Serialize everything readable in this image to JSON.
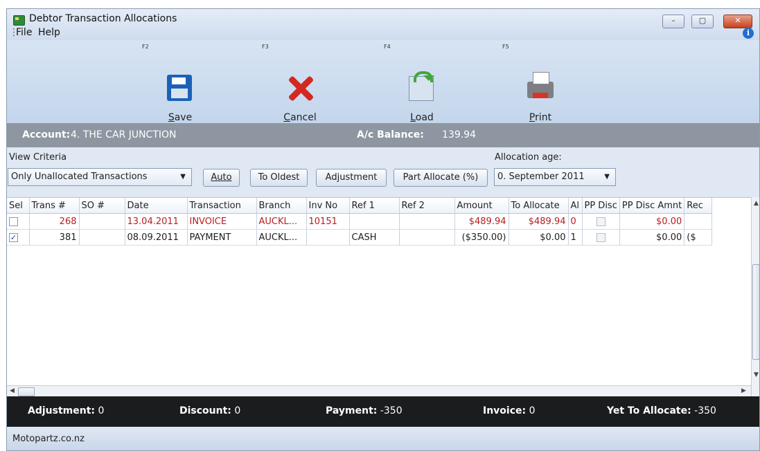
{
  "window": {
    "title": "Debtor Transaction Allocations"
  },
  "menu": {
    "items": [
      "File",
      "Help"
    ]
  },
  "toolbar": {
    "tools": [
      {
        "fkey": "F2",
        "label": "Save",
        "accel": "S",
        "icon": "save-icon"
      },
      {
        "fkey": "F3",
        "label": "Cancel",
        "accel": "C",
        "icon": "cancel-icon"
      },
      {
        "fkey": "F4",
        "label": "Load",
        "accel": "L",
        "icon": "load-icon"
      },
      {
        "fkey": "F5",
        "label": "Print",
        "accel": "P",
        "icon": "print-icon"
      }
    ]
  },
  "account": {
    "label": "Account:",
    "value": "4. THE CAR JUNCTION",
    "balance_label": "A/c Balance:",
    "balance_value": "139.94"
  },
  "criteria": {
    "view_label": "View Criteria",
    "view_value": "Only Unallocated Transactions",
    "buttons": [
      "Auto",
      "To Oldest",
      "Adjustment",
      "Part Allocate (%)"
    ],
    "age_label": "Allocation age:",
    "age_value": "0. September 2011"
  },
  "grid": {
    "columns": [
      "Sel",
      "Trans #",
      "SO #",
      "Date",
      "Transaction",
      "Branch",
      "Inv No",
      "Ref 1",
      "Ref 2",
      "Amount",
      "To Allocate",
      "Al",
      "PP Disc",
      "PP Disc Amnt",
      "Rec"
    ],
    "rows": [
      {
        "sel": false,
        "trans": "268",
        "so": "",
        "date": "13.04.2011",
        "transaction": "INVOICE",
        "branch": "AUCKL...",
        "inv": "10151",
        "ref1": "",
        "ref2": "",
        "amount": "$489.94",
        "to_allocate": "$489.94",
        "al": "0",
        "pp_disc": false,
        "pp_disc_amnt": "$0.00",
        "rec": ""
      },
      {
        "sel": true,
        "trans": "381",
        "so": "",
        "date": "08.09.2011",
        "transaction": "PAYMENT",
        "branch": "AUCKL...",
        "inv": "",
        "ref1": "CASH",
        "ref2": "",
        "amount": "($350.00)",
        "to_allocate": "$0.00",
        "al": "1",
        "pp_disc": false,
        "pp_disc_amnt": "$0.00",
        "rec": "($"
      }
    ]
  },
  "summary": [
    {
      "label": "Adjustment:",
      "value": "0"
    },
    {
      "label": "Discount:",
      "value": "0"
    },
    {
      "label": "Payment:",
      "value": "-350"
    },
    {
      "label": "Invoice:",
      "value": "0"
    },
    {
      "label": "Yet To Allocate:",
      "value": "-350"
    }
  ],
  "status": {
    "text": "Motopartz.co.nz"
  },
  "colors": {
    "invoice_text": "#b81c1c",
    "summary_bg": "#1b1c1e",
    "account_bar": "#8d96a1"
  }
}
